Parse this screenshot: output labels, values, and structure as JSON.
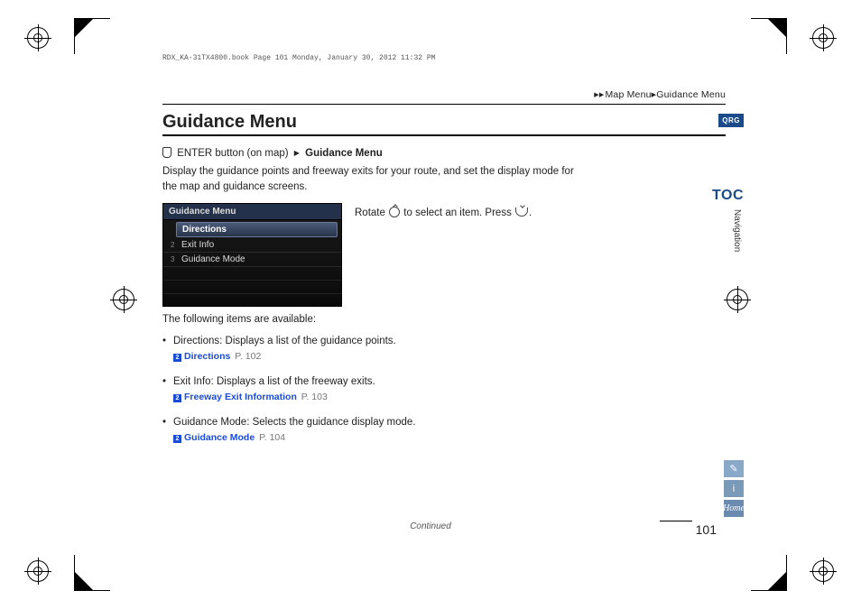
{
  "header_line": "RDX_KA-31TX4800.book  Page 101  Monday, January 30, 2012  11:32 PM",
  "breadcrumb": {
    "a": "Map Menu",
    "b": "Guidance Menu"
  },
  "title": "Guidance Menu",
  "nav_path": {
    "part1": "ENTER button (on map)",
    "part2": "Guidance Menu"
  },
  "intro": "Display the guidance points and freeway exits for your route, and set the display mode for the map and guidance screens.",
  "screenshot": {
    "title": "Guidance Menu",
    "items": [
      {
        "n": "",
        "label": "Directions",
        "sel": true
      },
      {
        "n": "2",
        "label": "Exit Info"
      },
      {
        "n": "3",
        "label": "Guidance Mode"
      }
    ]
  },
  "instruction": {
    "a": "Rotate",
    "b": "to select an item. Press",
    "c": "."
  },
  "following": "The following items are available:",
  "items": [
    {
      "name": "Directions",
      "desc": ": Displays a list of the guidance points.",
      "xref": "Directions",
      "pg": "P. 102"
    },
    {
      "name": "Exit Info",
      "desc": ": Displays a list of the freeway exits.",
      "xref": "Freeway Exit Information",
      "pg": "P. 103"
    },
    {
      "name": "Guidance Mode",
      "desc": ": Selects the guidance display mode.",
      "xref": "Guidance Mode",
      "pg": "P. 104"
    }
  ],
  "tabs": {
    "qrg": "QRG",
    "toc": "TOC",
    "section": "Navigation"
  },
  "sidebtns": {
    "b1": "✎",
    "b2": "i",
    "b3": "Home"
  },
  "continued": "Continued",
  "pagenum": "101"
}
